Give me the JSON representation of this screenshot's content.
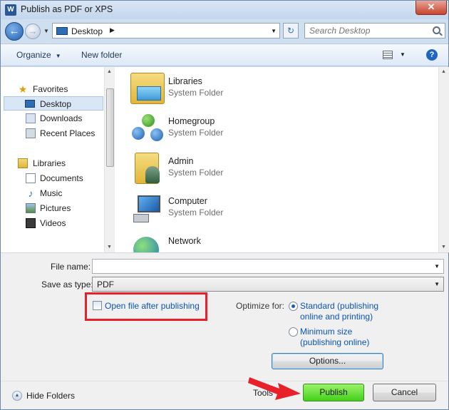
{
  "window": {
    "title": "Publish as PDF or XPS",
    "app_icon": "W"
  },
  "address": {
    "path": "Desktop",
    "search_placeholder": "Search Desktop"
  },
  "toolbar": {
    "organize": "Organize",
    "new_folder": "New folder"
  },
  "nav": {
    "items": [
      {
        "label": "Favorites",
        "icon": "star-icon"
      },
      {
        "label": "Desktop",
        "icon": "desktop-icon",
        "selected": true
      },
      {
        "label": "Downloads",
        "icon": "downloads-icon"
      },
      {
        "label": "Recent Places",
        "icon": "recent-places-icon"
      },
      {
        "label": "Libraries",
        "icon": "libraries-icon"
      },
      {
        "label": "Documents",
        "icon": "documents-icon"
      },
      {
        "label": "Music",
        "icon": "music-icon"
      },
      {
        "label": "Pictures",
        "icon": "pictures-icon"
      },
      {
        "label": "Videos",
        "icon": "videos-icon"
      }
    ]
  },
  "content": {
    "items": [
      {
        "name": "Libraries",
        "type": "System Folder",
        "icon": "libraries-folder-icon"
      },
      {
        "name": "Homegroup",
        "type": "System Folder",
        "icon": "homegroup-icon"
      },
      {
        "name": "Admin",
        "type": "System Folder",
        "icon": "user-folder-icon"
      },
      {
        "name": "Computer",
        "type": "System Folder",
        "icon": "computer-icon"
      },
      {
        "name": "Network",
        "type": "",
        "icon": "network-icon"
      }
    ]
  },
  "form": {
    "file_name_label": "File name:",
    "file_name_value": "",
    "save_type_label": "Save as type:",
    "save_type_value": "PDF",
    "open_after_label": "Open file after publishing",
    "open_after_checked": false,
    "optimize_label": "Optimize for:",
    "standard_line1": "Standard (publishing",
    "standard_line2": "online and printing)",
    "minimum_line1": "Minimum size",
    "minimum_line2": "(publishing online)",
    "selected_option": "standard",
    "options_button": "Options..."
  },
  "footer": {
    "hide_folders": "Hide Folders",
    "tools": "Tools",
    "publish": "Publish",
    "cancel": "Cancel"
  },
  "colors": {
    "highlight": "#e8202a",
    "publish": "#43d11a",
    "link": "#0b54b6"
  }
}
